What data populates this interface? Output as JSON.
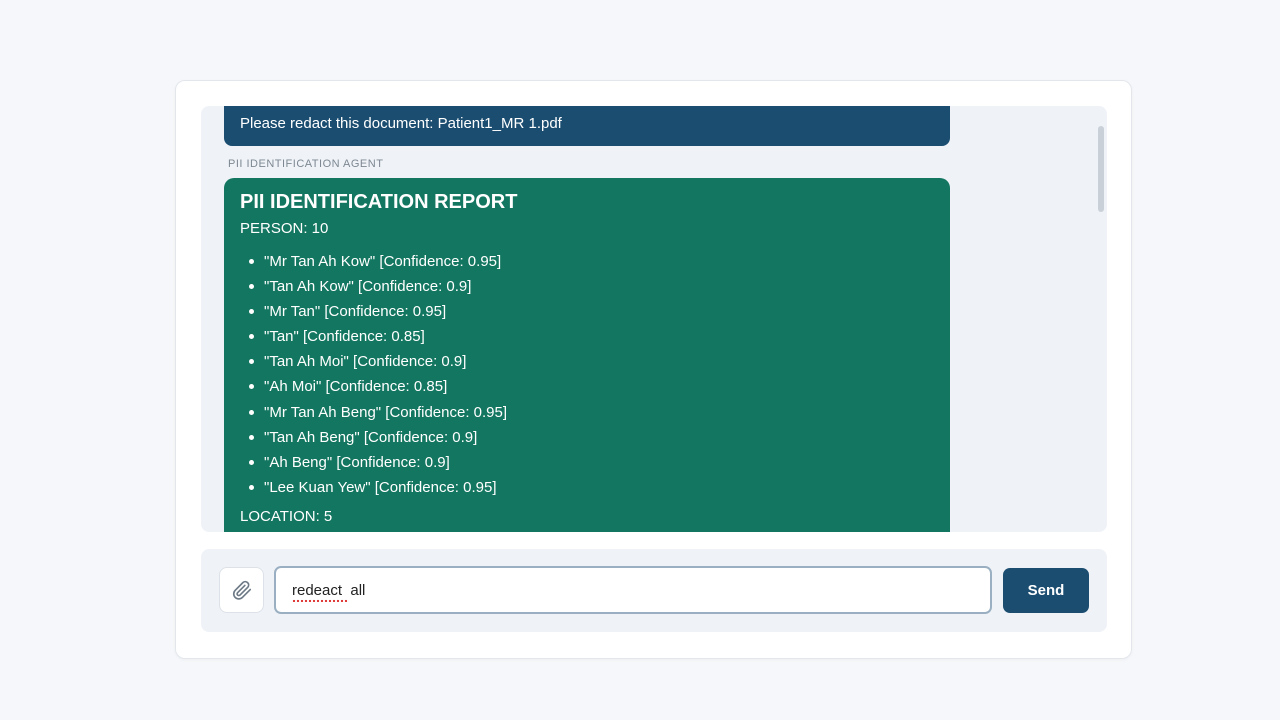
{
  "chat": {
    "user_message": "Please redact this document: Patient1_MR 1.pdf",
    "agent_label": "PII IDENTIFICATION AGENT",
    "report": {
      "title": "PII IDENTIFICATION REPORT",
      "person_heading": "PERSON: 10",
      "persons": [
        "\"Mr Tan Ah Kow\" [Confidence: 0.95]",
        "\"Tan Ah Kow\" [Confidence: 0.9]",
        "\"Mr Tan\" [Confidence: 0.95]",
        "\"Tan\" [Confidence: 0.85]",
        "\"Tan Ah Moi\" [Confidence: 0.9]",
        "\"Ah Moi\" [Confidence: 0.85]",
        "\"Mr Tan Ah Beng\" [Confidence: 0.95]",
        "\"Tan Ah Beng\" [Confidence: 0.9]",
        "\"Ah Beng\" [Confidence: 0.9]",
        "\"Lee Kuan Yew\" [Confidence: 0.95]"
      ],
      "location_heading": "LOCATION: 5"
    }
  },
  "composer": {
    "input_value": "redeact  all",
    "send_label": "Send",
    "attach_icon": "paperclip-icon"
  },
  "colors": {
    "user_bubble": "#1b4d70",
    "agent_bubble": "#137660",
    "send_button": "#1b4d70"
  }
}
